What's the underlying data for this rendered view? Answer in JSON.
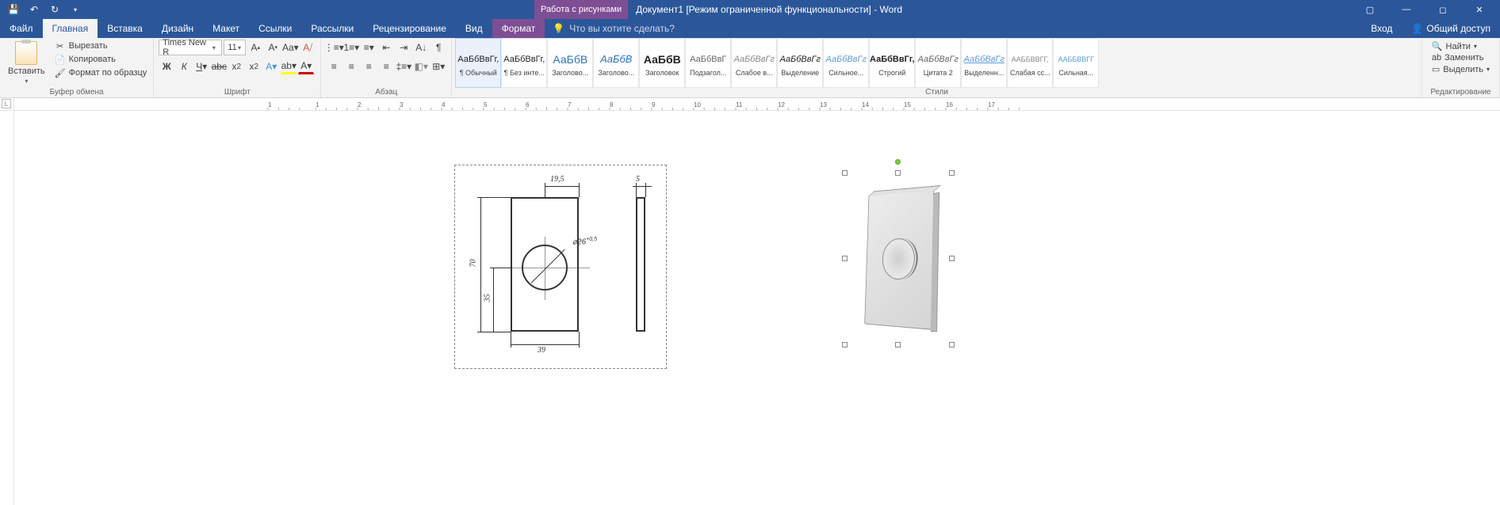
{
  "titlebar": {
    "context_tab": "Работа с рисунками",
    "title": "Документ1 [Режим ограниченной функциональности] - Word"
  },
  "tabs": {
    "file": "Файл",
    "home": "Главная",
    "insert": "Вставка",
    "design": "Дизайн",
    "layout": "Макет",
    "references": "Ссылки",
    "mailings": "Рассылки",
    "review": "Рецензирование",
    "view": "Вид",
    "format": "Формат",
    "tellme_placeholder": "Что вы хотите сделать?",
    "signin": "Вход",
    "share": "Общий доступ"
  },
  "clipboard": {
    "paste": "Вставить",
    "cut": "Вырезать",
    "copy": "Копировать",
    "format_painter": "Формат по образцу",
    "group": "Буфер обмена"
  },
  "font": {
    "name": "Times New R",
    "size": "11",
    "group": "Шрифт"
  },
  "paragraph": {
    "group": "Абзац"
  },
  "styles": {
    "group": "Стили",
    "items": [
      {
        "preview": "АаБбВвГг,",
        "name": "¶ Обычный",
        "sel": true,
        "cls": ""
      },
      {
        "preview": "АаБбВвГг,",
        "name": "¶ Без инте...",
        "cls": ""
      },
      {
        "preview": "АаБбВ",
        "name": "Заголово...",
        "cls": "color:#2e74b5;font-size:14px"
      },
      {
        "preview": "АаБбВ",
        "name": "Заголово...",
        "cls": "color:#2e74b5;font-size:13px;font-style:italic"
      },
      {
        "preview": "АаБбВ",
        "name": "Заголовок",
        "cls": "font-size:14px;font-weight:bold"
      },
      {
        "preview": "АаБбВвГ",
        "name": "Подзагол...",
        "cls": "color:#666"
      },
      {
        "preview": "АаБбВвГг",
        "name": "Слабое в...",
        "cls": "color:#888;font-style:italic"
      },
      {
        "preview": "АаБбВвГг",
        "name": "Выделение",
        "cls": "font-style:italic"
      },
      {
        "preview": "АаБбВвГг",
        "name": "Сильное...",
        "cls": "color:#5b9bd5;font-style:italic"
      },
      {
        "preview": "АаБбВвГг,",
        "name": "Строгий",
        "cls": "font-weight:bold"
      },
      {
        "preview": "АаБбВвГг",
        "name": "Цитата 2",
        "cls": "color:#666;font-style:italic"
      },
      {
        "preview": "АаБбВвГг",
        "name": "Выделенн...",
        "cls": "color:#5b9bd5;font-style:italic;text-decoration:underline"
      },
      {
        "preview": "ААББВВГГ,",
        "name": "Слабая сс...",
        "cls": "font-size:9px;color:#888"
      },
      {
        "preview": "ААББВВГГ",
        "name": "Сильная...",
        "cls": "font-size:9px;color:#5b9bd5"
      }
    ]
  },
  "editing": {
    "find": "Найти",
    "replace": "Заменить",
    "select": "Выделить",
    "group": "Редактирование"
  },
  "drawing": {
    "dim_width_top": "19,5",
    "dim_thickness": "5",
    "dim_height": "70",
    "dim_center_y": "35",
    "dim_width_bottom": "39",
    "dim_diameter": "⌀26",
    "dim_tol": "+0,5"
  },
  "ruler": {
    "nums": [
      "1",
      "1",
      "2",
      "3",
      "4",
      "5",
      "6",
      "7",
      "8",
      "9",
      "10",
      "11",
      "12",
      "13",
      "14",
      "15",
      "16",
      "17"
    ]
  }
}
